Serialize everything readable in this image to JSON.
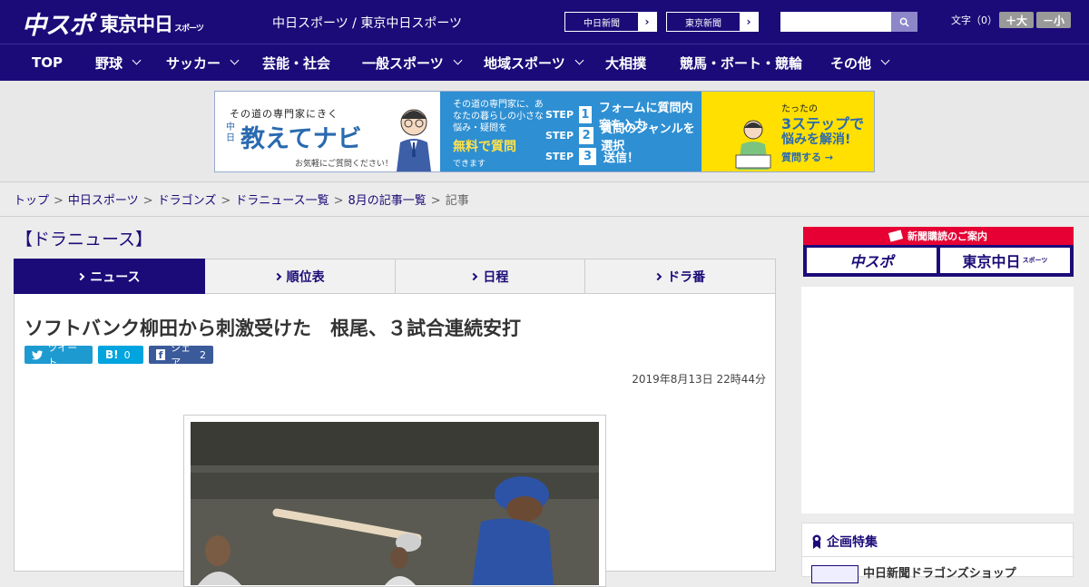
{
  "header": {
    "logo_chuspo": "中スポ",
    "logo_tokyo": "東京中日",
    "logo_tokyo_small": "スポーツ",
    "tagline": "中日スポーツ / 東京中日スポーツ",
    "paper_links": [
      "中日新聞",
      "東京新聞"
    ],
    "font_size_label": "文字（0）",
    "font_larger": "＋大",
    "font_smaller": "－小"
  },
  "nav": [
    {
      "label": "TOP"
    },
    {
      "label": "野球"
    },
    {
      "label": "サッカー"
    },
    {
      "label": "芸能・社会"
    },
    {
      "label": "一般スポーツ"
    },
    {
      "label": "地域スポーツ"
    },
    {
      "label": "大相撲"
    },
    {
      "label": "競馬・ボート・競輪"
    },
    {
      "label": "その他"
    }
  ],
  "ad": {
    "left_tagline": "その道の専門家にきく",
    "left_chu": "中日",
    "left_title": "教えてナビ",
    "left_note": "お気軽にご質問ください！",
    "mid_desc": "その道の専門家に、あなたの暮らしの小さな悩み・疑問を",
    "mid_free": "無料で質問",
    "mid_can": "できます",
    "steps": [
      {
        "step": "STEP",
        "num": "1",
        "text": "フォームに質問内容を入力"
      },
      {
        "step": "STEP",
        "num": "2",
        "text": "質問のジャンルを選択"
      },
      {
        "step": "STEP",
        "num": "3",
        "text": "送信！"
      }
    ],
    "right_top": "たったの",
    "right_big": "3ステップで",
    "right_mid": "悩みを解消!",
    "right_btn": "質問する →"
  },
  "breadcrumbs": [
    "トップ",
    "中日スポーツ",
    "ドラゴンズ",
    "ドラニュース一覧",
    "8月の記事一覧"
  ],
  "breadcrumb_current": "記事",
  "breadcrumb_sep": ">",
  "section_title": "【ドラニュース】",
  "tabs": [
    {
      "label": "ニュース",
      "active": true
    },
    {
      "label": "順位表",
      "active": false
    },
    {
      "label": "日程",
      "active": false
    },
    {
      "label": "ドラ番",
      "active": false
    }
  ],
  "article": {
    "headline": "ソフトバンク柳田から刺激受けた　根尾、３試合連続安打",
    "date": "2019年8月13日 22時44分"
  },
  "share": {
    "tweet": "ツイート",
    "hatena_icon": "B!",
    "hatena_count": "0",
    "facebook_icon": "f",
    "facebook_label": "シェア",
    "facebook_count": "2"
  },
  "sidebar": {
    "subscription_title": "新聞購読のご案内",
    "logo_chuspo": "中スポ",
    "logo_tokyo": "東京中日",
    "logo_tokyo_small": "スポーツ",
    "feature_heading": "企画特集",
    "feature_item": "中日新聞ドラゴンズショップ"
  },
  "colors": {
    "brand_navy": "#1b0b78",
    "twitter": "#1d9bd1",
    "hatena": "#00a4de",
    "facebook": "#3b5a9a",
    "subscription_red": "#e60033"
  }
}
